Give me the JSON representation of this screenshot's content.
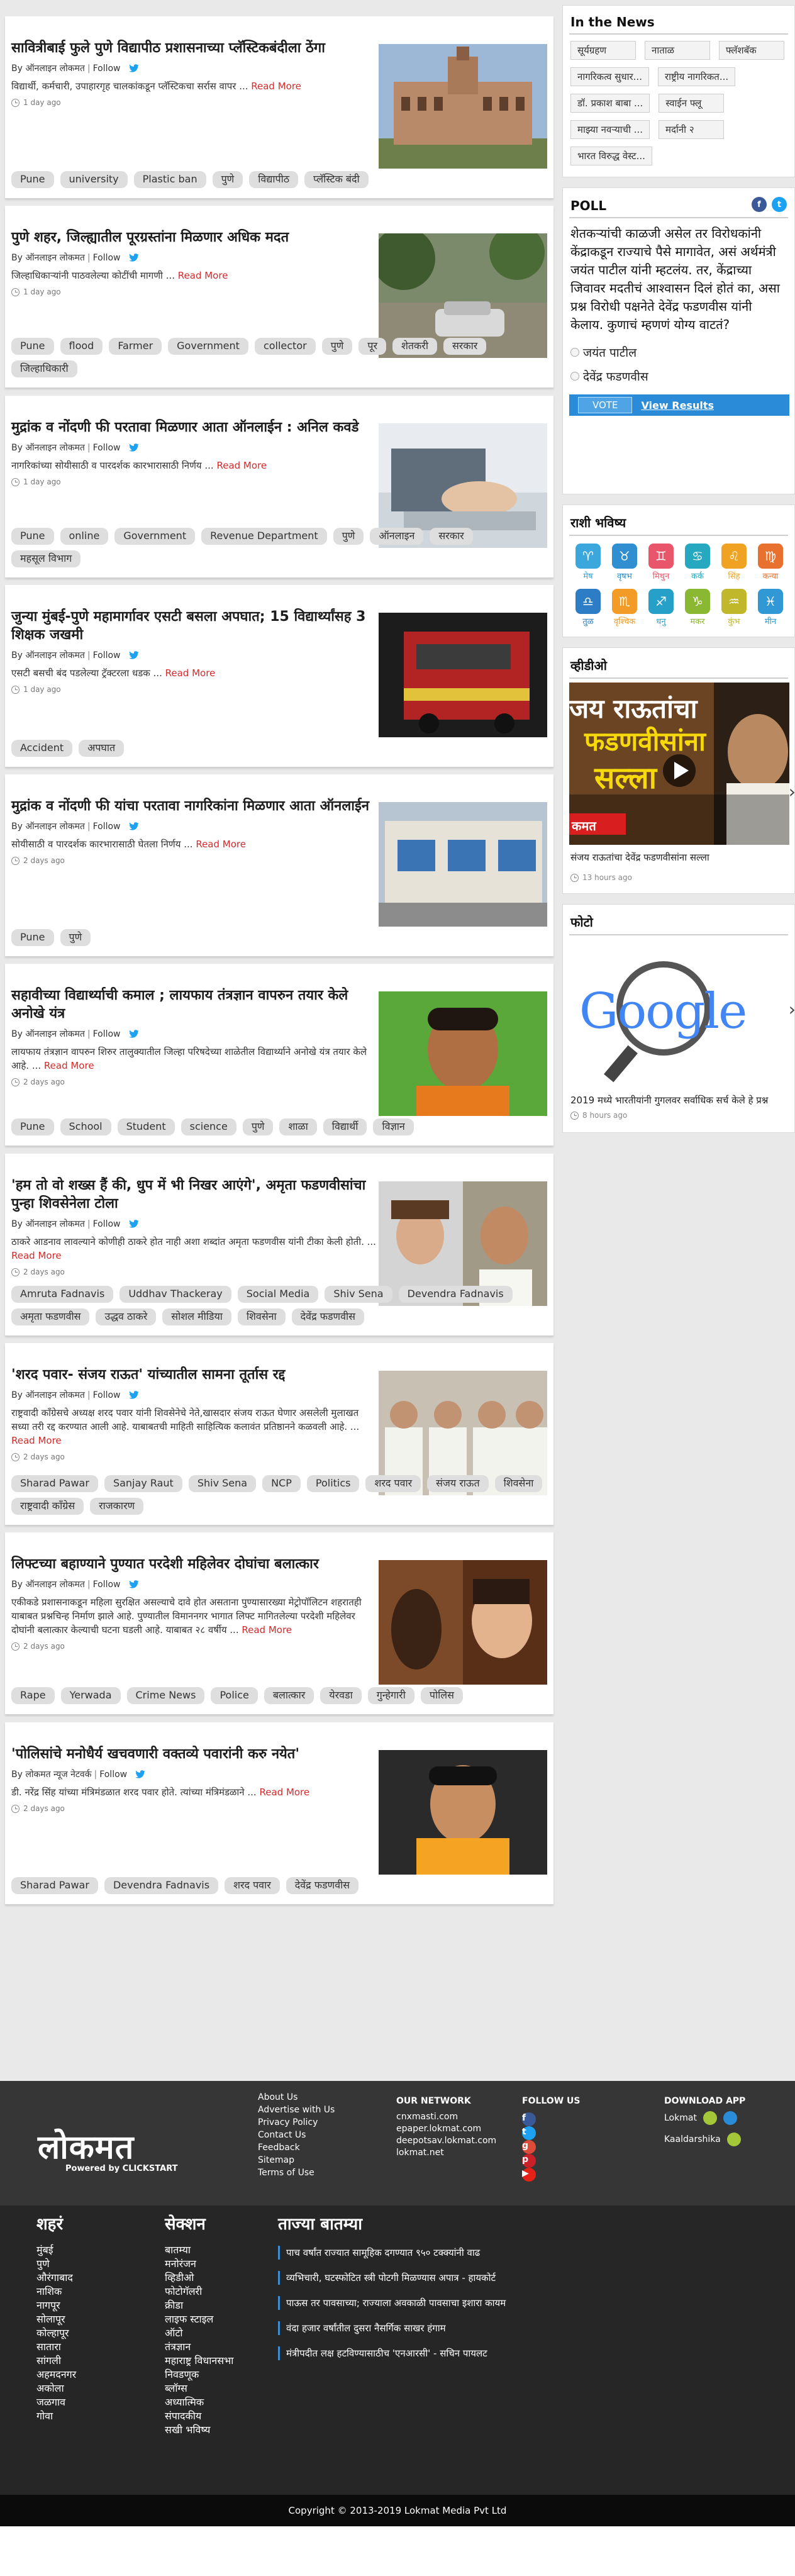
{
  "articles": [
    {
      "title": "सावित्रीबाई फुले पुणे विद्यापीठ प्रशासनाच्या प्लॅस्टिकबंदीला ठेंगा",
      "author": "By ऑनलाइन लोकमत",
      "follow": "Follow",
      "summary": "विद्यार्थी, कर्मचारी, उपाहारगृह चालकांकडून प्लॅस्टिकचा सर्रास वापर ...",
      "more": "Read More",
      "time": "1 day ago",
      "tags": [
        "Pune",
        "university",
        "Plastic ban",
        "पुणे",
        "विद्यापीठ",
        "प्लॅस्टिक बंदी"
      ],
      "img": "building"
    },
    {
      "title": "पुणे शहर, जिल्ह्यातील पूरग्रस्तांना मिळणार अधिक मदत",
      "author": "By ऑनलाइन लोकमत",
      "follow": "Follow",
      "summary": "जिल्हाधिकाऱ्यांनी पाठवलेल्या कोटींची मागणी ...",
      "more": "Read More",
      "time": "1 day ago",
      "tags": [
        "Pune",
        "flood",
        "Farmer",
        "Government",
        "collector",
        "पुणे",
        "पूर",
        "शेतकरी",
        "सरकार",
        "जिल्हाधिकारी"
      ],
      "img": "flood"
    },
    {
      "title": "मुद्रांक व नोंदणी फी परतावा मिळणार आता ऑनलाईन : अनिल कवडे",
      "author": "By ऑनलाइन लोकमत",
      "follow": "Follow",
      "summary": "नागरिकांच्या सोयीसाठी व पारदर्शक कारभारासाठी निर्णय ...",
      "more": "Read More",
      "time": "1 day ago",
      "tags": [
        "Pune",
        "online",
        "Government",
        "Revenue Department",
        "पुणे",
        "ऑनलाइन",
        "सरकार",
        "महसूल विभाग"
      ],
      "img": "laptop"
    },
    {
      "title": "जुन्या मुंबई-पुणे महामार्गावर एसटी बसला अपघात; 15 विद्यार्थ्यांसह 3 शिक्षक जखमी",
      "author": "By ऑनलाइन लोकमत",
      "follow": "Follow",
      "summary": "एसटी बसची बंद पडलेल्या ट्रॅक्टरला धडक ...",
      "more": "Read More",
      "time": "1 day ago",
      "tags": [
        "Accident",
        "अपघात"
      ],
      "img": "bus"
    },
    {
      "title": "मुद्रांक व नोंदणी फी यांचा परतावा नागरिकांना मिळणार आता ऑनलाईन",
      "author": "By ऑनलाइन लोकमत",
      "follow": "Follow",
      "summary": "सोयीसाठी व पारदर्शक कारभारासाठी घेतला निर्णय ...",
      "more": "Read More",
      "time": "2 days ago",
      "tags": [
        "Pune",
        "पुणे"
      ],
      "img": "office"
    },
    {
      "title": "सहावीच्या विद्यार्थ्याची कमाल ; लायफाय तंत्रज्ञान वापरुन तयार केले अनोखे यंत्र",
      "author": "By ऑनलाइन लोकमत",
      "follow": "Follow",
      "summary": "लायफाय तंत्रज्ञान वापरुन शिरुर तालुक्यातील जिल्हा परिषदेच्या शाळेतील विद्यार्थ्याने अनोखे यंत्र तयार केले आहे. ...",
      "more": "Read More",
      "time": "2 days ago",
      "tags": [
        "Pune",
        "School",
        "Student",
        "science",
        "पुणे",
        "शाळा",
        "विद्यार्थी",
        "विज्ञान"
      ],
      "img": "boy"
    },
    {
      "title": "'हम तो वो शख्स हैं की, धुप में भी निखर आएंगे', अमृता फडणवीसांचा पुन्हा शिवसेनेला टोला",
      "author": "By ऑनलाइन लोकमत",
      "follow": "Follow",
      "summary": "ठाकरे आडनाव लावल्याने कोणीही ठाकरे होत नाही अशा शब्दांत अमृता फडणवीस यांनी टीका केली होती. ...",
      "more": "Read More",
      "time": "2 days ago",
      "tags": [
        "Amruta Fadnavis",
        "Uddhav Thackeray",
        "Social Media",
        "Shiv Sena",
        "Devendra Fadnavis",
        "अमृता फडणवीस",
        "उद्धव ठाकरे",
        "सोशल मीडिया",
        "शिवसेना",
        "देवेंद्र फडणवीस"
      ],
      "img": "two"
    },
    {
      "title": "'शरद पवार- संजय राऊत' यांच्यातील सामना तूर्तास रद्द",
      "author": "By ऑनलाइन लोकमत",
      "follow": "Follow",
      "summary": "राष्ट्रवादी काँग्रेसचे अध्यक्ष शरद पवार यांनी शिवसेनेचे नेते,खासदार संजय राऊत घेणार असलेली मुलाखत सध्या तरी रद्द करण्यात आली आहे. याबाबतची माहिती साहित्यिक कलावंत प्रतिष्ठानने कळवली आहे. ...",
      "more": "Read More",
      "time": "2 days ago",
      "tags": [
        "Sharad Pawar",
        "Sanjay Raut",
        "Shiv Sena",
        "NCP",
        "Politics",
        "शरद पवार",
        "संजय राऊत",
        "शिवसेना",
        "राष्ट्रवादी काँग्रेस",
        "राजकारण"
      ],
      "img": "group"
    },
    {
      "title": "लिफ्टच्या बहाण्याने पुण्यात परदेशी महिलेवर दोघांचा बलात्कार",
      "author": "By ऑनलाइन लोकमत",
      "follow": "Follow",
      "summary": "एकीकडे प्रशासनाकडून महिला सुरक्षित असल्याचे दावे होत असताना पुण्यासारख्या मेट्रोपॉलिटन शहरातही याबाबत प्रश्नचिन्ह निर्माण झाले आहे. पुण्यातील विमाननगर भागात लिफ्ट मागितलेल्या परदेशी महिलेवर दोघांनी बलात्कार केल्याची घटना घडली आहे. याबाबत २८ वर्षीय ...",
      "more": "Read More",
      "time": "2 days ago",
      "tags": [
        "Rape",
        "Yerwada",
        "Crime News",
        "Police",
        "बलात्कार",
        "येरवडा",
        "गुन्हेगारी",
        "पोलिस"
      ],
      "img": "victim"
    },
    {
      "title": "'पोलिसांचे मनोधैर्य खचवणारी वक्तव्ये पवारांनी करु नयेत'",
      "author": "By लोकमत न्यूज नेटवर्क",
      "follow": "Follow",
      "summary": "डी. नरेंद्र सिंह यांच्या मंत्रिमंडळात शरद पवार होते. त्यांच्या मंत्रिमंडळाने ...",
      "more": "Read More",
      "time": "2 days ago",
      "tags": [
        "Sharad Pawar",
        "Devendra Fadnavis",
        "शरद पवार",
        "देवेंद्र फडणवीस"
      ],
      "img": "man"
    }
  ],
  "news": {
    "title": "In the News",
    "tags": [
      "सूर्यग्रहण",
      "नाताळ",
      "फ्लॅशबॅक",
      "नागरिकत्व सुधार...",
      "राष्ट्रीय नागरिकत...",
      "डॉ. प्रकाश बाबा ...",
      "स्वाईन फ्लू",
      "माझ्या नवऱ्याची ...",
      "मर्दानी २",
      "भारत विरुद्ध वेस्ट..."
    ]
  },
  "poll": {
    "title": "POLL",
    "question": "शेतकऱ्यांची काळजी असेल तर विरोधकांनी केंद्राकडून राज्याचे पैसे मागावेत, असं अर्थमंत्री जयंत पाटील यांनी म्हटलंय. तर, केंद्राच्या जिवावर मदतीचं आश्वासन दिलं होतं का, असा प्रश्न विरोधी पक्षनेते देवेंद्र फडणवीस यांनी केलाय. कुणाचं म्हणणं योग्य वाटतं?",
    "options": [
      "जयंत पाटील",
      "देवेंद्र फडणवीस"
    ],
    "vote": "VOTE",
    "results": "View Results",
    "fb": "f",
    "tw": "t"
  },
  "rashi": {
    "title": "राशी भविष्य",
    "items": [
      {
        "name": "मेष",
        "color": "#3ca7dc"
      },
      {
        "name": "वृषभ",
        "color": "#2f8fd1"
      },
      {
        "name": "मिथुन",
        "color": "#e9556b"
      },
      {
        "name": "कर्क",
        "color": "#26a8c1"
      },
      {
        "name": "सिंह",
        "color": "#f0a323"
      },
      {
        "name": "कन्या",
        "color": "#e8712f"
      },
      {
        "name": "तुळ",
        "color": "#2d7dc6"
      },
      {
        "name": "वृश्चिक",
        "color": "#f29b26"
      },
      {
        "name": "धनु",
        "color": "#27a0c9"
      },
      {
        "name": "मकर",
        "color": "#8bb832"
      },
      {
        "name": "कुंभ",
        "color": "#c1b72a"
      },
      {
        "name": "मीन",
        "color": "#3099d5"
      }
    ]
  },
  "video": {
    "title": "व्हीडीओ",
    "overlay1": "जय राऊतांचा",
    "overlay2": "फडणवीसांना",
    "overlay3": "सल्ला",
    "brand": "कमत",
    "caption": "संजय राऊतांचा देवेंद्र फडणवीसांना सल्ला",
    "time": "13 hours ago"
  },
  "photo": {
    "title": "फोटो",
    "word": "Google",
    "caption": "2019 मध्ये भारतीयांनी गुगलवर सर्वाधिक सर्च केले हे प्रश्न",
    "time": "8 hours ago"
  },
  "footer": {
    "logo": "लोकमत",
    "powered": "Powered by CLICKSTART",
    "links": [
      "About Us",
      "Advertise with Us",
      "Privacy Policy",
      "Contact Us",
      "Feedback",
      "Sitemap",
      "Terms of Use"
    ],
    "network_title": "OUR NETWORK",
    "network": [
      "cnxmasti.com",
      "epaper.lokmat.com",
      "deepotsav.lokmat.com",
      "lokmat.net"
    ],
    "follow_title": "FOLLOW US",
    "app_title": "DOWNLOAD APP",
    "apps": [
      "Lokmat",
      "Kaaldarshika"
    ],
    "cities_title": "शहरं",
    "cities": [
      "मुंबई",
      "पुणे",
      "औरंगाबाद",
      "नाशिक",
      "नागपूर",
      "सोलापूर",
      "कोल्हापूर",
      "सातारा",
      "सांगली",
      "अहमदनगर",
      "अकोला",
      "जळगाव",
      "गोवा"
    ],
    "sections_title": "सेक्शन",
    "sections": [
      "बातम्या",
      "मनोरंजन",
      "व्हिडीओ",
      "फोटोगॅलरी",
      "क्रीडा",
      "लाइफ स्टाइल",
      "ऑटो",
      "तंत्रज्ञान",
      "महाराष्ट्र विधानसभा निवडणूक",
      "ब्लॉग्स",
      "अध्यात्मिक",
      "संपादकीय",
      "सखी भविष्य"
    ],
    "latest_title": "ताज्या बातम्या",
    "latest": [
      "पाच वर्षांत राज्यात सामूहिक दगण्यात ९५० टक्क्यांनी वाढ",
      "व्यभिचारी, घटस्फोटित स्त्री पोटगी मिळण्यास अपात्र - हायकोर्ट",
      "पाऊस तर पावसाच्या; राज्याला अवकाळी पावसाचा इशारा कायम",
      "वंदा हजार वर्षांतील दुसरा नैसर्गिक साखर हंगाम",
      "मंत्रीपदीत लक्ष हटविण्यासाठीच 'एनआरसी' - सचिन पायलट"
    ],
    "copyright": "Copyright © 2013-2019 Lokmat Media Pvt Ltd"
  }
}
